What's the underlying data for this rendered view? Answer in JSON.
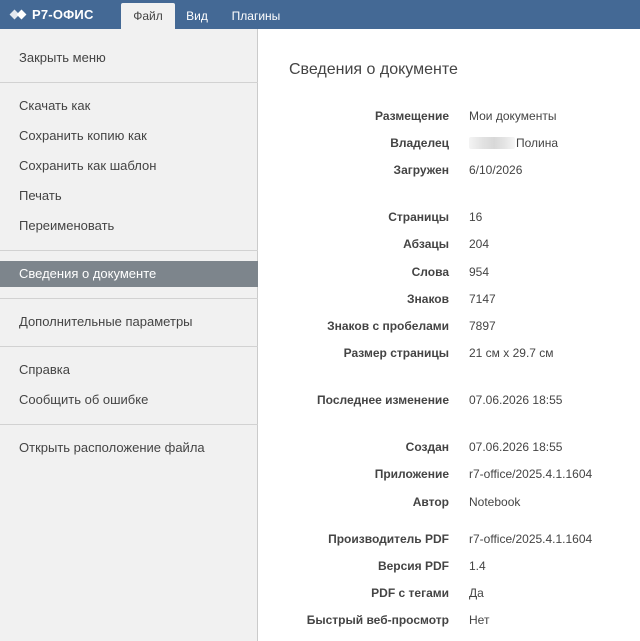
{
  "header": {
    "logo_text": "Р7-ОФИС",
    "tabs": [
      {
        "label": "Файл",
        "active": true
      },
      {
        "label": "Вид",
        "active": false
      },
      {
        "label": "Плагины",
        "active": false
      }
    ],
    "bar_color": "#446995"
  },
  "sidebar": {
    "items": [
      {
        "label": "Закрыть меню"
      },
      {
        "label": "Скачать как"
      },
      {
        "label": "Сохранить копию как"
      },
      {
        "label": "Сохранить как шаблон"
      },
      {
        "label": "Печать"
      },
      {
        "label": "Переименовать"
      },
      {
        "label": "Сведения о документе",
        "selected": true
      },
      {
        "label": "Дополнительные параметры"
      },
      {
        "label": "Справка"
      },
      {
        "label": "Сообщить об ошибке"
      },
      {
        "label": "Открыть расположение файла"
      }
    ]
  },
  "info": {
    "title": "Сведения о документе",
    "location_label": "Размещение",
    "location_value": "Мои документы",
    "owner_label": "Владелец",
    "owner_value": "Полина",
    "uploaded_label": "Загружен",
    "uploaded_value": "6/10/2026",
    "pages_label": "Страницы",
    "pages_value": "16",
    "paragraphs_label": "Абзацы",
    "paragraphs_value": "204",
    "words_label": "Слова",
    "words_value": "954",
    "symbols_label": "Знаков",
    "symbols_value": "7147",
    "spaces_label": "Знаков с пробелами",
    "spaces_value": "7897",
    "pagesize_label": "Размер страницы",
    "pagesize_value": "21 см x 29.7 см",
    "modified_label": "Последнее изменение",
    "modified_value": "07.06.2026 18:55",
    "created_label": "Создан",
    "created_value": "07.06.2026 18:55",
    "application_label": "Приложение",
    "application_value": "r7-office/2025.4.1.1604",
    "author_label": "Автор",
    "author_value": "Notebook",
    "pdfproducer_label": "Производитель PDF",
    "pdfproducer_value": "r7-office/2025.4.1.1604",
    "pdfver_label": "Версия PDF",
    "pdfver_value": "1.4",
    "tagged_label": "PDF с тегами",
    "tagged_value": "Да",
    "fastweb_label": "Быстрый веб-просмотр",
    "fastweb_value": "Нет"
  }
}
